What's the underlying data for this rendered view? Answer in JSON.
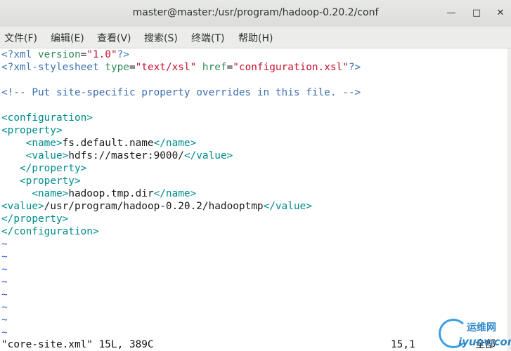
{
  "window": {
    "title": "master@master:/usr/program/hadoop-0.20.2/conf",
    "minimize_icon": "minimize-icon",
    "maximize_icon": "maximize-icon",
    "close_icon": "close-icon"
  },
  "menu": {
    "items": [
      "文件(F)",
      "编辑(E)",
      "查看(V)",
      "搜索(S)",
      "终端(T)",
      "帮助(H)"
    ]
  },
  "editor": {
    "l1": {
      "a": "<?",
      "b": "xml",
      "c": " version",
      "d": "=",
      "e": "\"1.0\"",
      "f": "?>"
    },
    "l2": {
      "a": "<?",
      "b": "xml-stylesheet",
      "c": " type",
      "d": "=",
      "e": "\"text/xsl\"",
      "g": " href",
      "h": "=",
      "i": "\"configuration.xsl\"",
      "f": "?>"
    },
    "l3": {
      "a": "<!-- Put site-specific property overrides in this file. -->"
    },
    "l4": {
      "a": "<configuration>"
    },
    "l5": {
      "a": "<property>"
    },
    "l6": {
      "indent": "    ",
      "a": "<name>",
      "b": "fs.default.name",
      "c": "</name>"
    },
    "l7": {
      "indent": "    ",
      "a": "<value>",
      "b": "hdfs://master:9000/",
      "c": "</value>"
    },
    "l8": {
      "indent": "   ",
      "a": "</property>"
    },
    "l9": {
      "indent": "   ",
      "a": "<property>"
    },
    "l10": {
      "indent": "     ",
      "a": "<name>",
      "b": "hadoop.tmp.dir",
      "c": "</name>"
    },
    "l11": {
      "a": "<value>",
      "b": "/usr/program/hadoop-0.20.2/hadooptmp",
      "c": "</value>"
    },
    "l12": {
      "a": "</property>"
    },
    "l13": {
      "a": "</configuration>"
    },
    "tilde": "~"
  },
  "status": {
    "file_info": "\"core-site.xml\" 15L, 389C",
    "position": "15,1",
    "scroll": "全部"
  },
  "watermark": {
    "text_cn": "运维网",
    "text_en": "iyunv.com"
  },
  "colors": {
    "tag": "#008b8b",
    "attribute": "#2e8b57",
    "string": "#c8102e",
    "comment": "#3e6fb0",
    "tilde": "#3355cc"
  }
}
